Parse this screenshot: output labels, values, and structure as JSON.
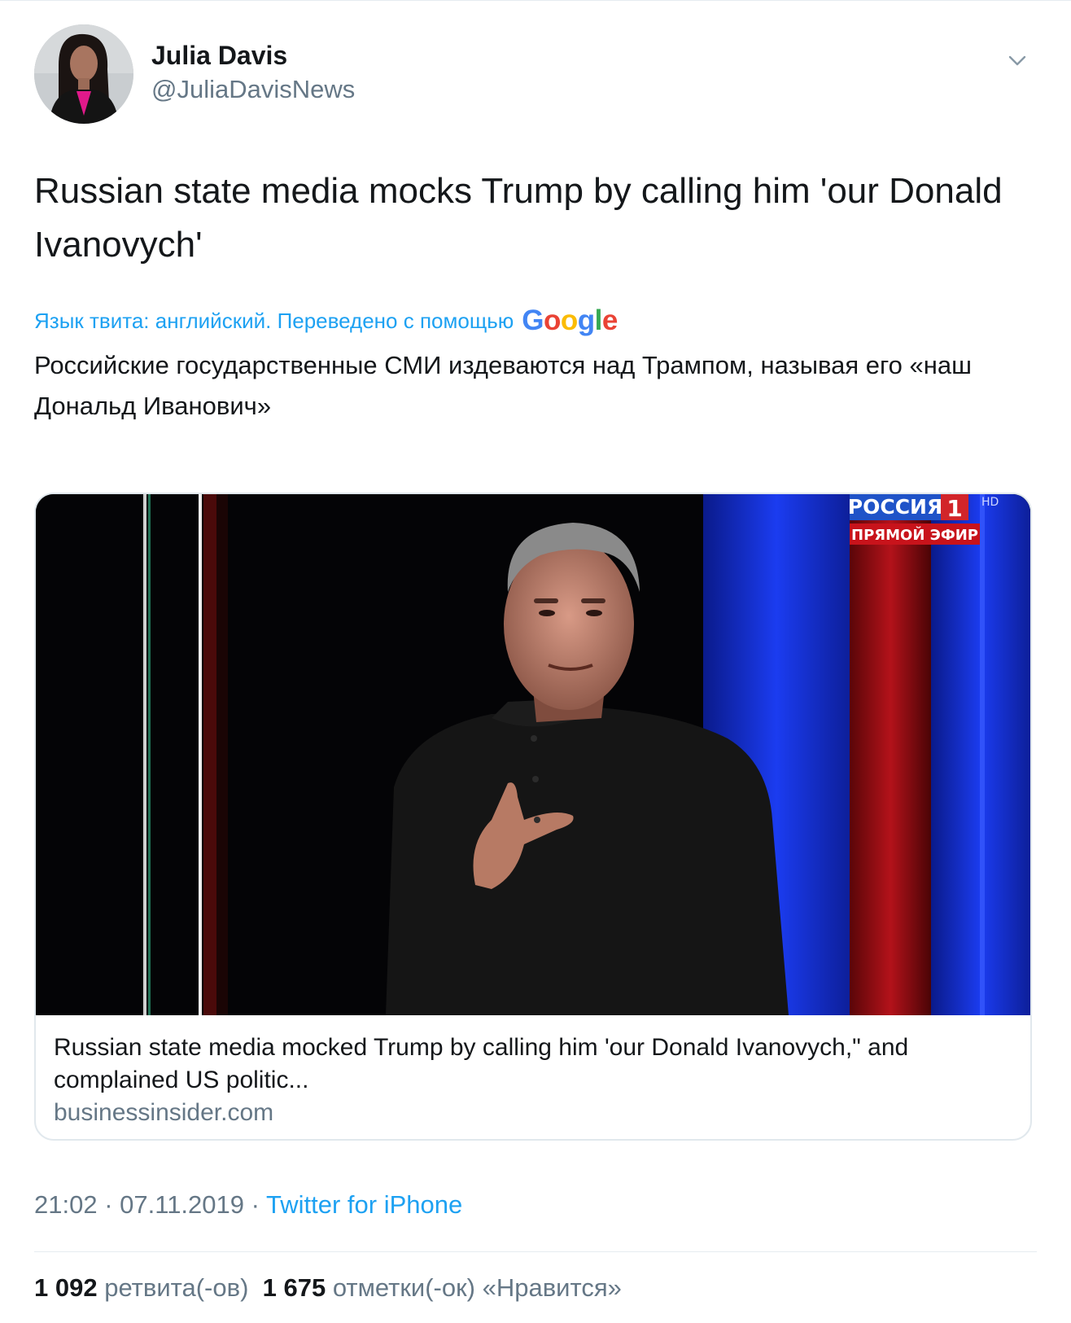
{
  "author": {
    "display_name": "Julia Davis",
    "handle": "@JuliaDavisNews"
  },
  "tweet": {
    "text": "Russian state media mocks Trump by calling him 'our Donald Ivanovych'",
    "translation_notice": "Язык твита: английский. Переведено с помощью",
    "translation_provider": "Google",
    "translated_text": "Российские государственные СМИ издеваются над Трампом, называя его «наш Дональд Иванович»"
  },
  "card": {
    "image_overlay": {
      "channel_name": "РОССИЯ",
      "channel_number": "1",
      "hd_label": "HD",
      "live_label": "ПРЯМОЙ ЭФИР"
    },
    "title": "Russian state media mocked Trump by calling him 'our Donald Ivanovych,\" and complained US politic...",
    "domain": "businessinsider.com"
  },
  "meta": {
    "time": "21:02",
    "separator": "·",
    "date": "07.11.2019",
    "source": "Twitter for iPhone"
  },
  "stats": {
    "retweets_count": "1 092",
    "retweets_label": "ретвита(-ов)",
    "likes_count": "1 675",
    "likes_label": "отметки(-ок) «Нравится»"
  },
  "colors": {
    "link_blue": "#1da1f2",
    "secondary_gray": "#657786",
    "text_dark": "#14171a",
    "border": "#e1e8ed"
  },
  "icons": [
    "chevron-down-icon"
  ]
}
